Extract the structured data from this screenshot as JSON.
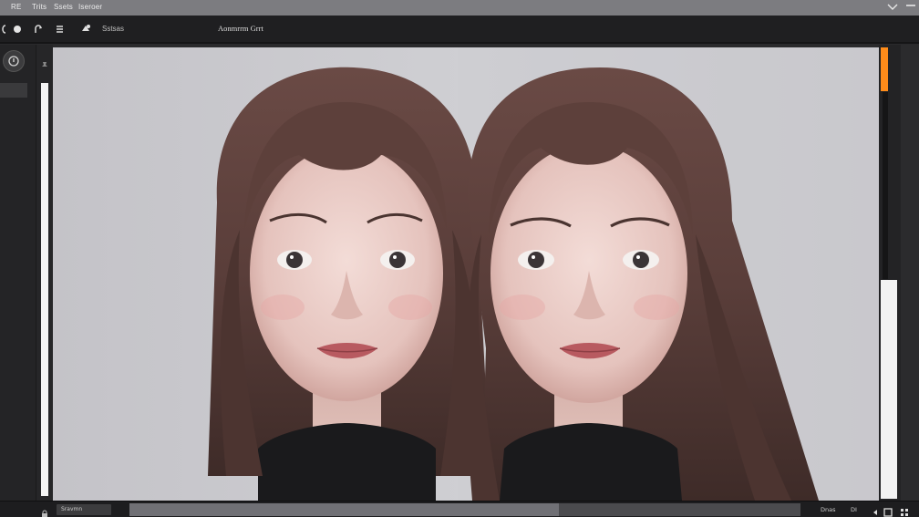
{
  "menu": {
    "items": [
      "RE",
      "Trits",
      "Ssets",
      "Iseroer"
    ]
  },
  "toolbar": {
    "save_label": "Sstsas",
    "title": "Aonmrrm Grrt"
  },
  "canvas": {
    "description_icons": [
      "portrait-left-face-icon",
      "portrait-right-face-icon"
    ],
    "background": "#c8c6ca"
  },
  "statusbar": {
    "field_value": "Sravmn",
    "zoom_label": "Dnas",
    "view_label": "DI",
    "progress": 0.64
  },
  "colors": {
    "accent": "#ff8c1a",
    "panel": "#1f1f21",
    "menubar": "#7c7c80"
  }
}
